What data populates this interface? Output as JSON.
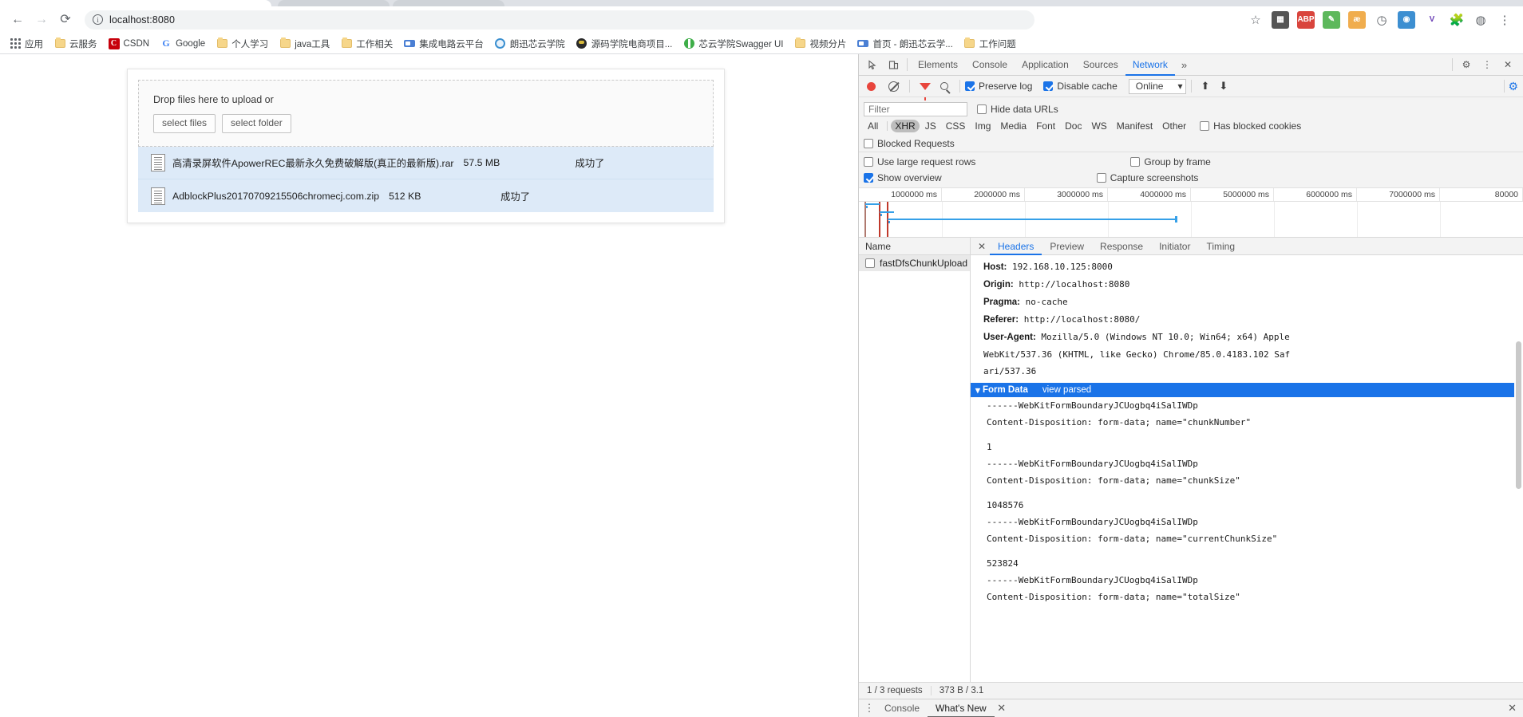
{
  "browser": {
    "nav": {
      "back": "←",
      "forward": "→",
      "reload": "⟳"
    },
    "omnibox": {
      "url": "localhost:8080",
      "security_icon": "info-icon"
    },
    "toolbar_icons": [
      "star-icon",
      "extension-puzzle-icon",
      "abp-extension-icon",
      "notes-extension-icon",
      "translate-extension-icon",
      "key-extension-icon",
      "clock-extension-icon",
      "camera-extension-icon",
      "v-extension-icon",
      "puzzle-icon",
      "profile-icon",
      "menu-icon"
    ]
  },
  "bookmarks": [
    {
      "label": "应用",
      "icon": "apps-grid-icon"
    },
    {
      "label": "云服务",
      "icon": "folder-icon"
    },
    {
      "label": "CSDN",
      "icon": "csdn-icon"
    },
    {
      "label": "Google",
      "icon": "google-icon"
    },
    {
      "label": "个人学习",
      "icon": "folder-icon"
    },
    {
      "label": "java工具",
      "icon": "folder-icon"
    },
    {
      "label": "工作相关",
      "icon": "folder-icon"
    },
    {
      "label": "集成电路云平台",
      "icon": "chip-icon"
    },
    {
      "label": "朗迅芯云学院",
      "icon": "blue-circle-icon"
    },
    {
      "label": "源码学院电商项目...",
      "icon": "dark-circle-icon"
    },
    {
      "label": "芯云学院Swagger UI",
      "icon": "green-circle-icon"
    },
    {
      "label": "视频分片",
      "icon": "folder-icon"
    },
    {
      "label": "首页 - 朗迅芯云学...",
      "icon": "chip-icon"
    },
    {
      "label": "工作问题",
      "icon": "folder-icon"
    }
  ],
  "uploader": {
    "drop_text": "Drop files here to upload or",
    "select_files_label": "select files",
    "select_folder_label": "select folder",
    "files": [
      {
        "name": "高清录屏软件ApowerREC最新永久免费破解版(真正的最新版).rar",
        "size": "57.5 MB",
        "status": "成功了"
      },
      {
        "name": "AdblockPlus20170709215506chromecj.com.zip",
        "size": "512 KB",
        "status": "成功了"
      }
    ]
  },
  "devtools": {
    "tabs": [
      {
        "label": "Elements",
        "active": false
      },
      {
        "label": "Console",
        "active": false
      },
      {
        "label": "Application",
        "active": false
      },
      {
        "label": "Sources",
        "active": false
      },
      {
        "label": "Network",
        "active": true
      }
    ],
    "more_label": "»",
    "controls": {
      "preserve_log": "Preserve log",
      "preserve_log_checked": true,
      "disable_cache": "Disable cache",
      "disable_cache_checked": true,
      "throttle": "Online"
    },
    "filter": {
      "placeholder": "Filter",
      "hide_data_urls": "Hide data URLs",
      "hide_data_urls_checked": false,
      "types": [
        "All",
        "XHR",
        "JS",
        "CSS",
        "Img",
        "Media",
        "Font",
        "Doc",
        "WS",
        "Manifest",
        "Other"
      ],
      "selected_type": "XHR",
      "has_blocked_cookies": "Has blocked cookies",
      "has_blocked_cookies_checked": false,
      "blocked_requests": "Blocked Requests",
      "blocked_requests_checked": false
    },
    "options": {
      "use_large_request_rows": "Use large request rows",
      "use_large_request_rows_checked": false,
      "group_by_frame": "Group by frame",
      "group_by_frame_checked": false,
      "show_overview": "Show overview",
      "show_overview_checked": true,
      "capture_screenshots": "Capture screenshots",
      "capture_screenshots_checked": false
    },
    "overview_ticks": [
      "1000000 ms",
      "2000000 ms",
      "3000000 ms",
      "4000000 ms",
      "5000000 ms",
      "6000000 ms",
      "7000000 ms",
      "80000"
    ],
    "request_table": {
      "header": "Name",
      "rows": [
        {
          "name": "fastDfsChunkUpload"
        }
      ]
    },
    "detail_tabs": [
      {
        "label": "Headers",
        "active": true
      },
      {
        "label": "Preview",
        "active": false
      },
      {
        "label": "Response",
        "active": false
      },
      {
        "label": "Initiator",
        "active": false
      },
      {
        "label": "Timing",
        "active": false
      }
    ],
    "headers": [
      {
        "key": "Host:",
        "value": " 192.168.10.125:8000"
      },
      {
        "key": "Origin:",
        "value": " http://localhost:8080"
      },
      {
        "key": "Pragma:",
        "value": " no-cache"
      },
      {
        "key": "Referer:",
        "value": " http://localhost:8080/"
      },
      {
        "key": "User-Agent:",
        "value": " Mozilla/5.0 (Windows NT 10.0; Win64; x64) Apple"
      },
      {
        "key": "",
        "value": "WebKit/537.36 (KHTML, like Gecko) Chrome/85.0.4183.102 Saf"
      },
      {
        "key": "",
        "value": "ari/537.36"
      }
    ],
    "form_data": {
      "title": "Form Data",
      "view_parsed": "view parsed",
      "lines": [
        "------WebKitFormBoundaryJCUogbq4iSalIWDp",
        "Content-Disposition: form-data; name=\"chunkNumber\"",
        "",
        "1",
        "------WebKitFormBoundaryJCUogbq4iSalIWDp",
        "Content-Disposition: form-data; name=\"chunkSize\"",
        "",
        "1048576",
        "------WebKitFormBoundaryJCUogbq4iSalIWDp",
        "Content-Disposition: form-data; name=\"currentChunkSize\"",
        "",
        "523824",
        "------WebKitFormBoundaryJCUogbq4iSalIWDp",
        "Content-Disposition: form-data; name=\"totalSize\""
      ]
    },
    "status": {
      "requests": "1 / 3 requests",
      "transferred": "373 B / 3.1 "
    },
    "drawer": {
      "console_label": "Console",
      "whats_new_label": "What's New"
    }
  },
  "colors": {
    "accent": "#1a73e8",
    "record": "#e8453c",
    "row_selected": "#ddeaf8",
    "overview_bar": "#35a0e8"
  }
}
